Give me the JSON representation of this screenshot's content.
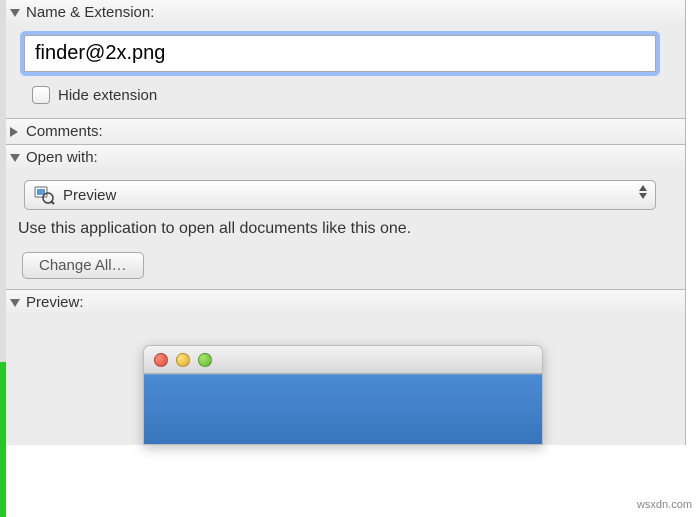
{
  "sections": {
    "name_ext": {
      "label": "Name & Extension:"
    },
    "comments": {
      "label": "Comments:"
    },
    "open_with": {
      "label": "Open with:"
    },
    "preview": {
      "label": "Preview:"
    }
  },
  "filename": {
    "value": "finder@2x.png"
  },
  "hide_extension": {
    "label": "Hide extension",
    "checked": false
  },
  "open_with": {
    "selected": "Preview",
    "hint": "Use this application to open all documents like this one.",
    "change_all_label": "Change All…"
  },
  "watermark": "wsxdn.com"
}
